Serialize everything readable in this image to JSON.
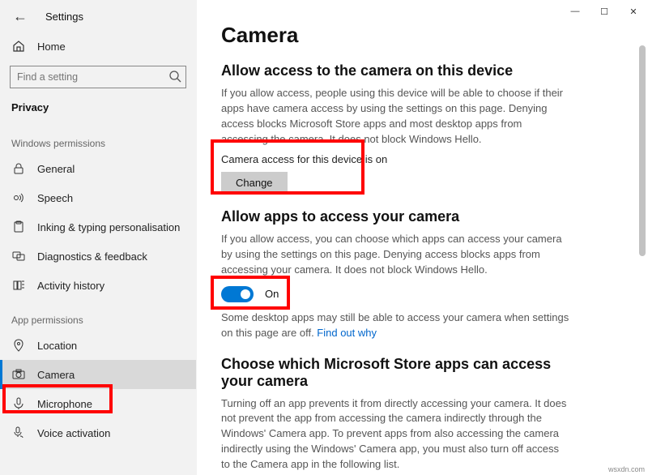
{
  "window": {
    "app_title": "Settings",
    "min": "—",
    "max": "☐",
    "close": "✕"
  },
  "sidebar": {
    "home": "Home",
    "search_placeholder": "Find a setting",
    "privacy": "Privacy",
    "section_windows": "Windows permissions",
    "section_app": "App permissions",
    "items_win": [
      {
        "label": "General"
      },
      {
        "label": "Speech"
      },
      {
        "label": "Inking & typing personalisation"
      },
      {
        "label": "Diagnostics & feedback"
      },
      {
        "label": "Activity history"
      }
    ],
    "items_app": [
      {
        "label": "Location"
      },
      {
        "label": "Camera"
      },
      {
        "label": "Microphone"
      },
      {
        "label": "Voice activation"
      }
    ]
  },
  "main": {
    "title": "Camera",
    "s1_heading": "Allow access to the camera on this device",
    "s1_desc": "If you allow access, people using this device will be able to choose if their apps have camera access by using the settings on this page. Denying access blocks Microsoft Store apps and most desktop apps from accessing the camera. It does not block Windows Hello.",
    "s1_status": "Camera access for this device is on",
    "s1_button": "Change",
    "s2_heading": "Allow apps to access your camera",
    "s2_desc": "If you allow access, you can choose which apps can access your camera by using the settings on this page. Denying access blocks apps from accessing your camera. It does not block Windows Hello.",
    "s2_toggle_label": "On",
    "s2_note": "Some desktop apps may still be able to access your camera when settings on this page are off. ",
    "s2_link": "Find out why",
    "s3_heading": "Choose which Microsoft Store apps can access your camera",
    "s3_desc": "Turning off an app prevents it from directly accessing your camera. It does not prevent the app from accessing the camera indirectly through the Windows' Camera app. To prevent apps from also accessing the camera indirectly using the Windows' Camera app, you must also turn off access to the Camera app in the following list."
  },
  "watermark": "wsxdn.com"
}
